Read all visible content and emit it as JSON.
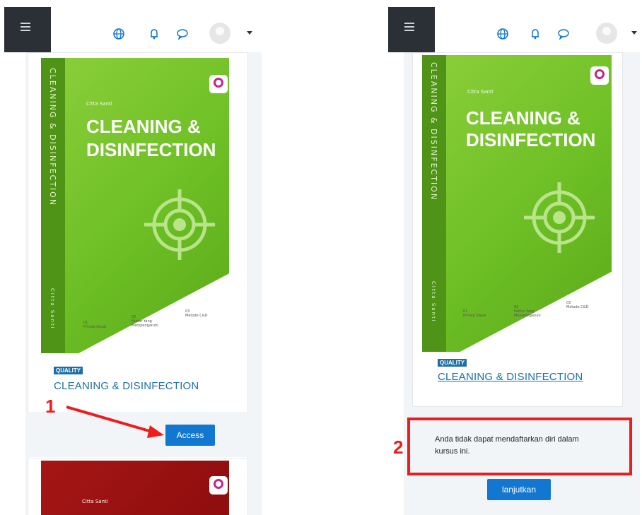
{
  "left": {
    "book": {
      "spine_text": "CLEANING & DISINFECTION",
      "spine_author": "Citta Santi",
      "author": "Citta Santi",
      "title_line1": "CLEANING &",
      "title_line2": "DISINFECTION",
      "info": [
        {
          "num": "01",
          "text": "Prinsip Dasar"
        },
        {
          "num": "02",
          "text": "Faktor Yang Mempengaruhi"
        },
        {
          "num": "03",
          "text": "Metode C&D"
        }
      ]
    },
    "category": "QUALITY",
    "course_title": "CLEANING & DISINFECTION",
    "access_label": "Access",
    "next_author": "Citta Santi"
  },
  "right": {
    "book": {
      "spine_text": "CLEANING & DISINFECTION",
      "spine_author": "Citta Santi",
      "author": "Citta Santi",
      "title_line1": "CLEANING &",
      "title_line2": "DISINFECTION",
      "info": [
        {
          "num": "01",
          "text": "Prinsip Dasar"
        },
        {
          "num": "02",
          "text": "Faktor Yang Mempengaruhi"
        },
        {
          "num": "03",
          "text": "Metode C&D"
        }
      ]
    },
    "category": "QUALITY",
    "course_title": "CLEANING & DISINFECTION",
    "notice": "Anda tidak dapat mendaftarkan diri dalam kursus ini.",
    "continue_label": "lanjutkan"
  },
  "annotations": {
    "step1": "1",
    "step2": "2"
  },
  "colors": {
    "accent": "#1177d1",
    "annotation": "#ee1c1c",
    "cover_green": "#6dbf25",
    "badge": "#1c6fa8"
  },
  "icons": [
    "menu-icon",
    "globe-icon",
    "bell-icon",
    "chat-icon",
    "avatar",
    "caret-down-icon",
    "q-logo-icon",
    "target-icon"
  ]
}
